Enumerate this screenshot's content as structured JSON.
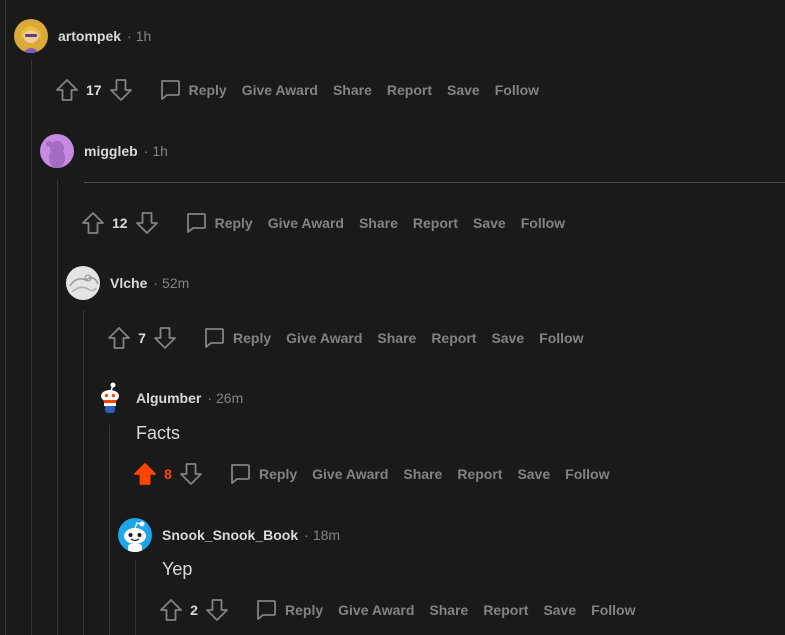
{
  "colors": {
    "upvote_active": "#ff4500",
    "muted": "#818384",
    "text": "#d7dadc",
    "background": "#1a1a1b"
  },
  "comments": [
    {
      "username": "artompek",
      "time": "1h",
      "avatar": "yellow-avatar",
      "body": "",
      "score": "17",
      "upvoted": false
    },
    {
      "username": "miggleb",
      "time": "1h",
      "avatar": "purple-snoo-avatar",
      "body": "",
      "score": "12",
      "upvoted": false
    },
    {
      "username": "Vlche",
      "time": "52m",
      "avatar": "grey-sketch-avatar",
      "body": "",
      "score": "7",
      "upvoted": false
    },
    {
      "username": "Algumber",
      "time": "26m",
      "avatar": "snoo-avatar",
      "body": "Facts",
      "score": "8",
      "upvoted": true
    },
    {
      "username": "Snook_Snook_Book",
      "time": "18m",
      "avatar": "blue-snoo-avatar",
      "body": "Yep",
      "score": "2",
      "upvoted": false
    }
  ],
  "actions": {
    "reply": "Reply",
    "give_award": "Give Award",
    "share": "Share",
    "report": "Report",
    "save": "Save",
    "follow": "Follow"
  },
  "separator": "·"
}
